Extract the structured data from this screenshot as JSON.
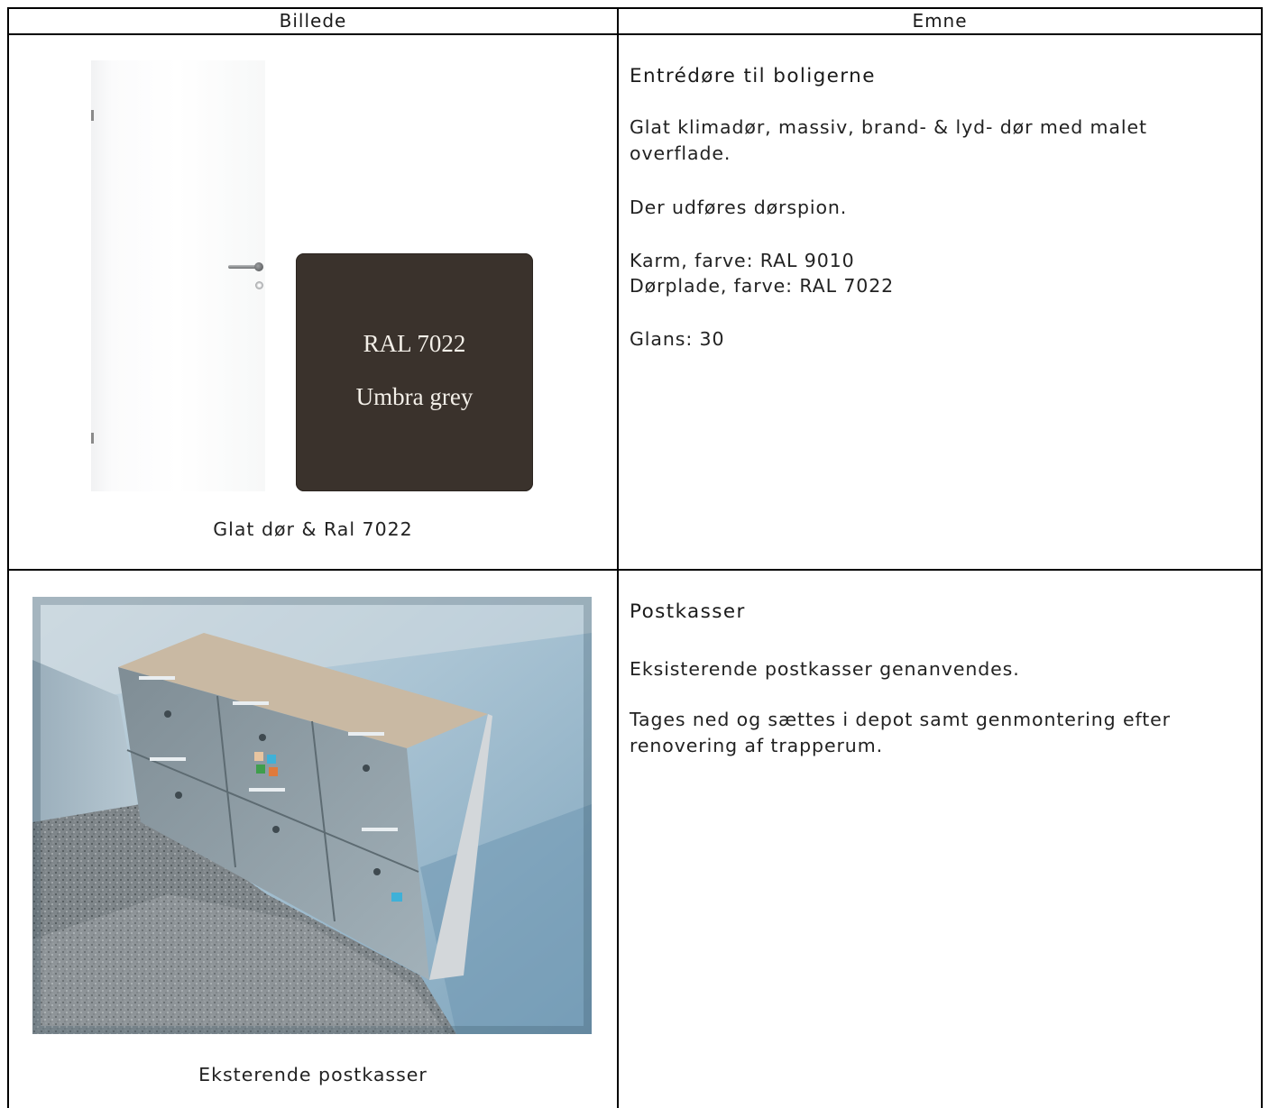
{
  "header": {
    "col1": "Billede",
    "col2": "Emne"
  },
  "rows": [
    {
      "swatch": {
        "line1": "RAL 7022",
        "line2": "Umbra grey",
        "color": "#3a322c"
      },
      "caption": "Glat dør & Ral 7022",
      "title": "Entrédøre til boligerne",
      "paragraphs": [
        "Glat klimadør, massiv, brand- & lyd- dør med malet",
        "overflade.",
        "Der udføres dørspion.",
        "Karm, farve: RAL 9010",
        "Dørplade, farve: RAL 7022",
        "Glans: 30"
      ]
    },
    {
      "caption": "Eksterende postkasser",
      "title": "Postkasser",
      "paragraphs": [
        "Eksisterende postkasser genanvendes.",
        "Tages ned og sættes i depot samt genmontering efter",
        "renovering af trapperum."
      ]
    }
  ],
  "colors": {
    "grid": "#000000",
    "text": "#222222",
    "wall": "#8fb0c4",
    "mailbox": "#8a9aa4"
  }
}
